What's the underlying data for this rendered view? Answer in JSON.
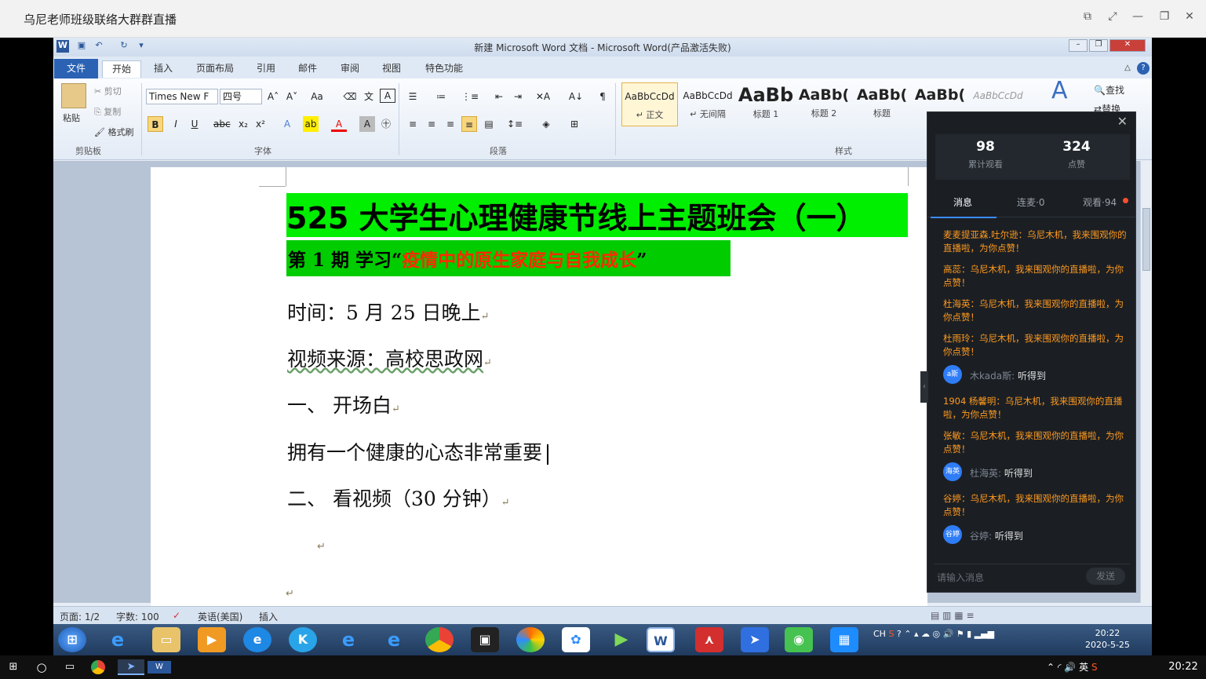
{
  "outer_window": {
    "title": "乌尼老师班级联络大群群直播"
  },
  "word": {
    "app_title": "新建 Microsoft Word 文档 - Microsoft Word(产品激活失败)",
    "tabs": [
      "文件",
      "开始",
      "插入",
      "页面布局",
      "引用",
      "邮件",
      "审阅",
      "视图",
      "特色功能"
    ],
    "clipboard": {
      "paste": "粘贴",
      "cut": "剪切",
      "copy": "复制",
      "format_painter": "格式刷",
      "label": "剪贴板"
    },
    "font": {
      "name": "Times New F",
      "size": "四号",
      "label": "字体"
    },
    "paragraph": {
      "label": "段落"
    },
    "styles": {
      "label": "样式",
      "items": [
        {
          "sample": "AaBbCcDd",
          "name": "↵ 正文"
        },
        {
          "sample": "AaBbCcDd",
          "name": "↵ 无间隔"
        },
        {
          "sample": "AaBb",
          "name": "标题 1"
        },
        {
          "sample": "AaBb(",
          "name": "标题 2"
        },
        {
          "sample": "AaBb(",
          "name": "标题"
        },
        {
          "sample": "AaBb(",
          "name": ""
        },
        {
          "sample": "AaBbCcDd",
          "name": ""
        }
      ],
      "find": "查找",
      "replace": "替换"
    },
    "document": {
      "title": "525 大学生心理健康节线上主题班会（一）",
      "subtitle_prefix": "第 1 期   学习“",
      "subtitle_red": "疫情中的原生家庭与自我成长",
      "subtitle_suffix": "”",
      "lines": [
        "时间：5 月 25 日晚上",
        "视频来源：高校思政网",
        "一、  开场白",
        "拥有一个健康的心态非常重要",
        "二、  看视频（30 分钟）"
      ],
      "paragraph_mark": "↵"
    },
    "status": {
      "page": "页面: 1/2",
      "words": "字数: 100",
      "language": "英语(美国)",
      "mode": "插入"
    }
  },
  "live_panel": {
    "stats": [
      {
        "value": "98",
        "label": "累计观看"
      },
      {
        "value": "324",
        "label": "点赞"
      }
    ],
    "tabs": [
      "消息",
      "连麦·0",
      "观看·94"
    ],
    "messages": [
      {
        "type": "system",
        "text": "麦麦提亚森.吐尔逊：乌尼木机，我来围观你的直播啦，为你点赞！"
      },
      {
        "type": "system",
        "text": "高蕊：乌尼木机，我来围观你的直播啦，为你点赞！"
      },
      {
        "type": "system",
        "text": "杜海英：乌尼木机，我来围观你的直播啦，为你点赞！"
      },
      {
        "type": "system",
        "text": "杜雨玲：乌尼木机，我来围观你的直播啦，为你点赞！"
      },
      {
        "type": "chat",
        "avatar": "a斯",
        "name": "木kada斯:",
        "text": "听得到"
      },
      {
        "type": "system",
        "text": "1904 杨馨明：乌尼木机，我来围观你的直播啦，为你点赞！"
      },
      {
        "type": "system",
        "text": "张敏：乌尼木机，我来围观你的直播啦，为你点赞！"
      },
      {
        "type": "chat",
        "avatar": "海英",
        "name": "杜海英:",
        "text": "听得到"
      },
      {
        "type": "system",
        "text": "谷婷：乌尼木机，我来围观你的直播啦，为你点赞！"
      },
      {
        "type": "chat",
        "avatar": "谷婷",
        "name": "谷婷:",
        "text": "听得到"
      }
    ],
    "input_placeholder": "请输入消息",
    "send": "发送"
  },
  "inner_taskbar": {
    "tray_lang": "CH",
    "time": "20:22",
    "date": "2020-5-25"
  },
  "os_taskbar": {
    "ime": "英",
    "time": "20:22"
  },
  "colors": {
    "highlight_green": "#00ee00",
    "red_text": "#ff2a00",
    "word_blue": "#2b579a",
    "live_bg": "#1b1f24",
    "accent": "#3b8cff"
  }
}
